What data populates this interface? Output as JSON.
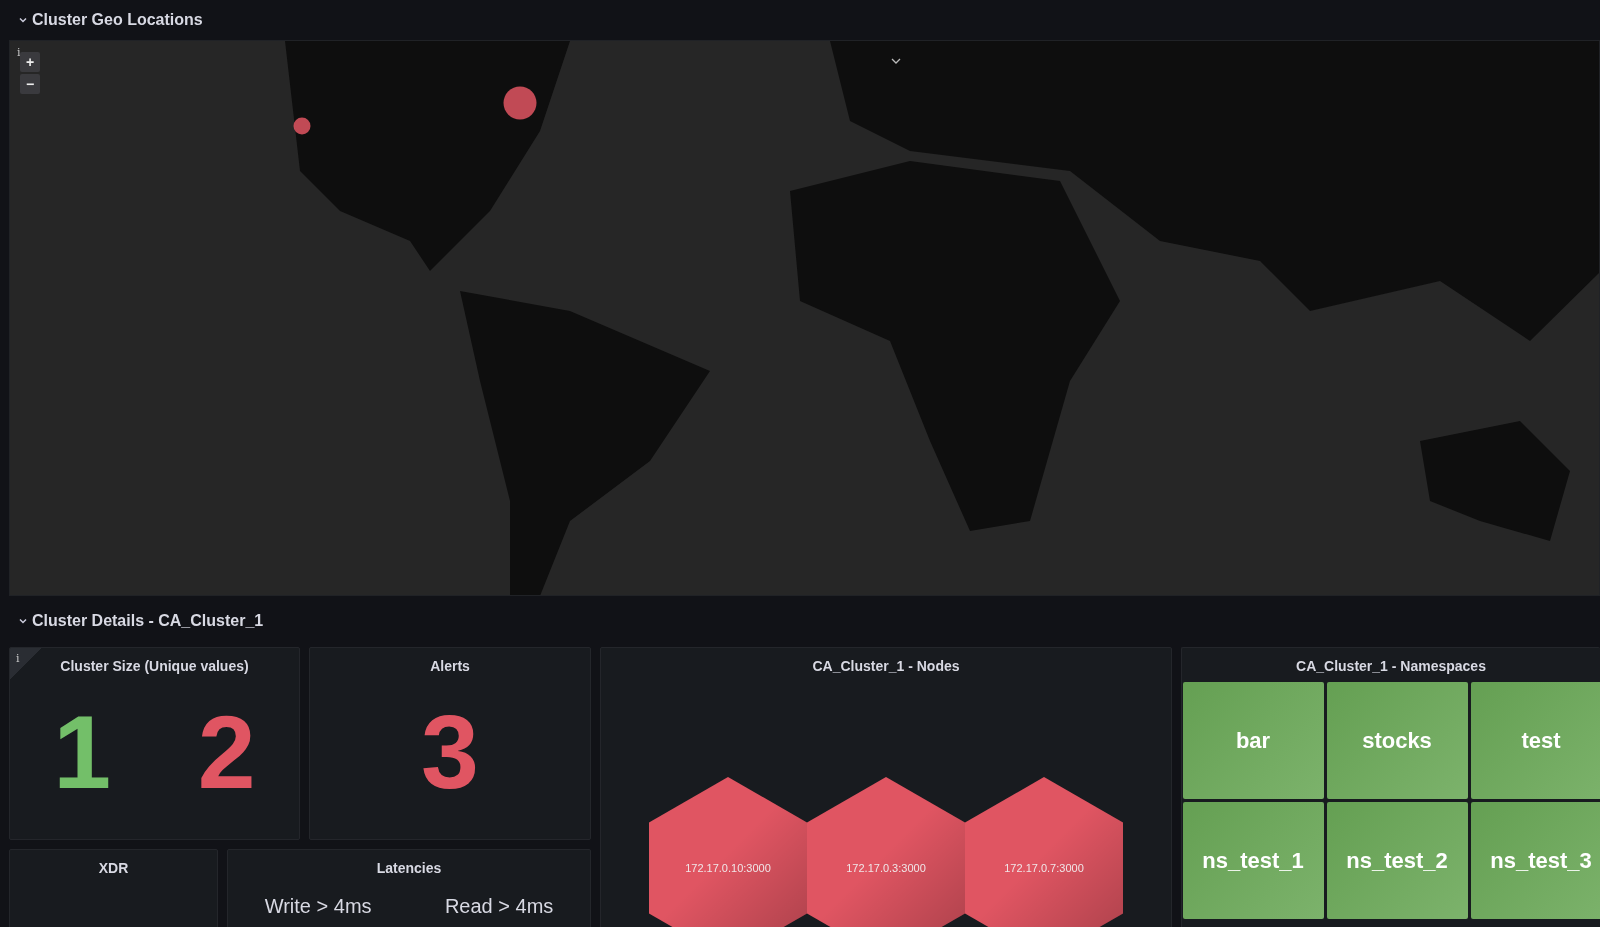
{
  "rows": [
    {
      "title": "Cluster Geo Locations",
      "expanded": true
    },
    {
      "title": "Cluster Details - CA_Cluster_1",
      "expanded": true
    }
  ],
  "map": {
    "info": "i",
    "zoom_in": "+",
    "zoom_out": "−"
  },
  "cluster_size": {
    "title": "Cluster Size (Unique values)",
    "info": "i",
    "values": [
      {
        "text": "1",
        "color": "#73bf69"
      },
      {
        "text": "2",
        "color": "#e05562"
      }
    ]
  },
  "alerts": {
    "title": "Alerts",
    "values": [
      {
        "text": "3",
        "color": "#e05562"
      }
    ]
  },
  "xdr": {
    "title": "XDR"
  },
  "latencies": {
    "title": "Latencies",
    "items": [
      "Write > 4ms",
      "Read > 4ms"
    ]
  },
  "nodes": {
    "title": "CA_Cluster_1 - Nodes",
    "items": [
      {
        "label": "172.17.0.10:3000",
        "color": "#e05562"
      },
      {
        "label": "172.17.0.3:3000",
        "color": "#e05562"
      },
      {
        "label": "172.17.0.7:3000",
        "color": "#e05562"
      }
    ]
  },
  "namespaces": {
    "title": "CA_Cluster_1 - Namespaces",
    "items": [
      {
        "label": "bar",
        "color": "#6aa857"
      },
      {
        "label": "stocks",
        "color": "#6aa857"
      },
      {
        "label": "test",
        "color": "#6aa857"
      },
      {
        "label": "ns_test_1",
        "color": "#6aa857"
      },
      {
        "label": "ns_test_2",
        "color": "#6aa857"
      },
      {
        "label": "ns_test_3",
        "color": "#6aa857"
      }
    ]
  }
}
